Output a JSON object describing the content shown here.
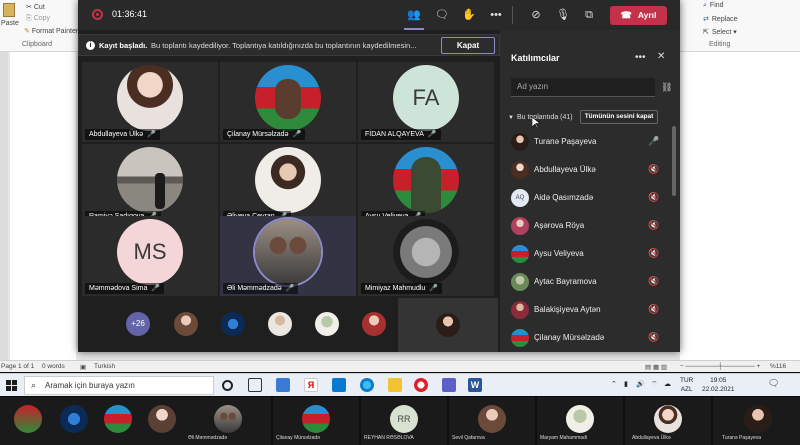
{
  "word": {
    "ribbon": {
      "paste": "Paste",
      "cut": "Cut",
      "copy": "Copy",
      "format_painter": "Format Painter",
      "clipboard": "Clipboard",
      "find": "Find",
      "replace": "Replace",
      "select": "Select",
      "editing": "Editing"
    },
    "status": {
      "page": "Page 1 of 1",
      "words": "0 words",
      "language": "Turkish",
      "zoom": "%116"
    }
  },
  "teams": {
    "timer": "01:36:41",
    "leave_label": "Ayrıl",
    "recording": {
      "title": "Kayıt başladı.",
      "description": "Bu toplantı kaydediliyor. Toplantıya katıldığınızda bu toplantının kaydedilmesin...",
      "close_label": "Kapat"
    },
    "tiles": [
      {
        "name": "Abdullayeva Ülkə",
        "initials": ""
      },
      {
        "name": "Çilanay Mürsəlzadə",
        "initials": ""
      },
      {
        "name": "FİDAN ALQAYEVA",
        "initials": "FA"
      },
      {
        "name": "Ramiyə Sadıqova",
        "initials": ""
      },
      {
        "name": "Əliyeva Ceyran",
        "initials": ""
      },
      {
        "name": "Aysu Veliyeva",
        "initials": ""
      },
      {
        "name": "Məmmədova Sima",
        "initials": "MS"
      },
      {
        "name": "Əli Məmmədzadə",
        "initials": ""
      },
      {
        "name": "Mimiyaz Mahmudlu",
        "initials": ""
      }
    ],
    "overflow_count": "+26",
    "panel": {
      "title": "Katılımcılar",
      "search_placeholder": "Ad yazın",
      "section": "Bu toplantıda (41)",
      "mute_all": "Tümünün sesini kapat",
      "participants": [
        "Turanə Paşayeva",
        "Abdullayeva Ülkə",
        "Aidə Qasımzadə",
        "Aşərova Röya",
        "Aysu Veliyeva",
        "Aytac Bayramova",
        "Balakişiyeva Aytən",
        "Çilanay Mürsəlzadə"
      ],
      "aq_initials": "AQ"
    }
  },
  "taskbar": {
    "search_placeholder": "Aramak için buraya yazın",
    "lang_top": "TUR",
    "lang_bottom": "AZL",
    "time": "19:05",
    "date": "22.02.2021"
  },
  "bottom_strip": {
    "labels": [
      "Əli Məmmədzadə",
      "Çilanay Mürsəlzadə",
      "REYHAN RƏSƏLOVA",
      "Sevil Qafarova",
      "Maryam Mahammadi",
      "Abdullayeva Ülkə",
      "Turanə Paşayeva"
    ],
    "rr_initials": "RR"
  }
}
